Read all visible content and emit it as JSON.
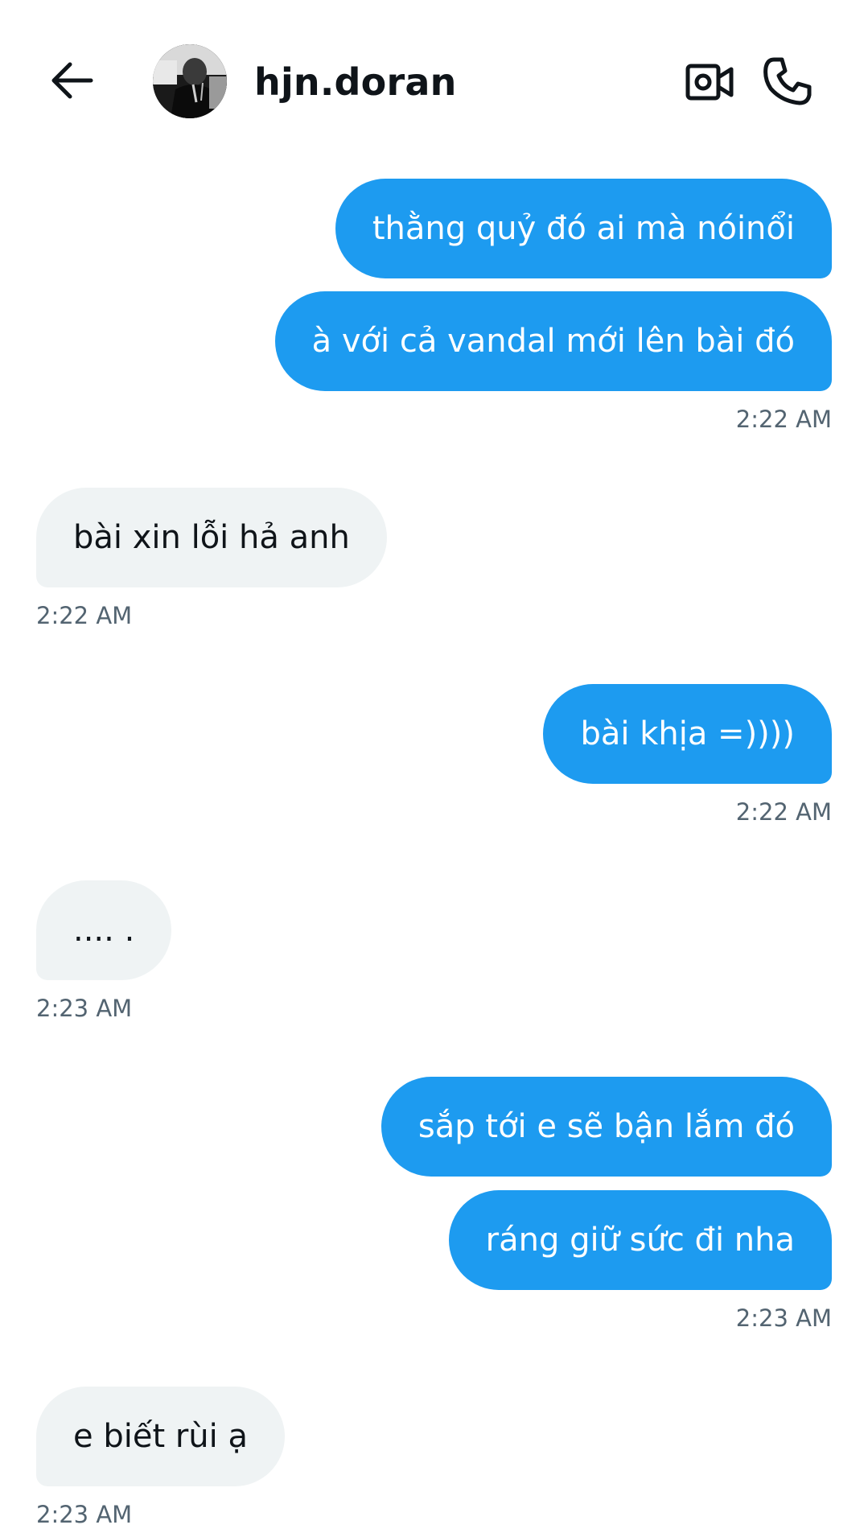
{
  "header": {
    "username": "hjn.doran"
  },
  "icons": {
    "back": "arrow-left-icon",
    "video": "video-camera-icon",
    "call": "phone-icon"
  },
  "colors": {
    "sent_bubble": "#1d9bf0",
    "received_bubble": "#eff3f4",
    "timestamp": "#536471"
  },
  "messages": [
    {
      "direction": "sent",
      "text": "thằng quỷ đó ai mà nóinổi"
    },
    {
      "direction": "sent",
      "text": "à với cả vandal mới lên bài đó"
    },
    {
      "direction": "received",
      "text": "bài xin lỗi hả anh"
    },
    {
      "direction": "sent",
      "text": "bài khịa =))))"
    },
    {
      "direction": "received",
      "text": ".... ."
    },
    {
      "direction": "sent",
      "text": "sắp tới e sẽ bận lắm đó"
    },
    {
      "direction": "sent",
      "text": "ráng giữ sức đi nha"
    },
    {
      "direction": "received",
      "text": "e biết rùi ạ"
    }
  ],
  "timestamps": [
    "2:22 AM",
    "2:22 AM",
    "2:22 AM",
    "2:23 AM",
    "2:23 AM",
    "2:23 AM"
  ]
}
